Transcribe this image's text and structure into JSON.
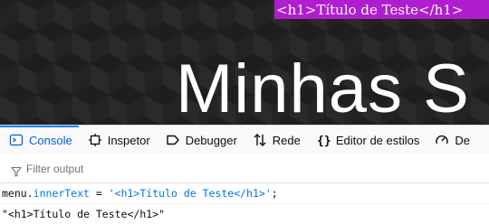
{
  "page": {
    "highlight_label": "<h1>Título de Teste</h1>",
    "hero_title": "Minhas S"
  },
  "devtools": {
    "tabs": [
      {
        "label": "Console",
        "icon": "console-icon",
        "selected": true
      },
      {
        "label": "Inspetor",
        "icon": "inspector-icon",
        "selected": false
      },
      {
        "label": "Debugger",
        "icon": "debugger-icon",
        "selected": false
      },
      {
        "label": "Rede",
        "icon": "network-icon",
        "selected": false
      },
      {
        "label": "Editor de estilos",
        "icon": "style-editor-icon",
        "selected": false
      },
      {
        "label": "De",
        "icon": "performance-icon",
        "selected": false
      }
    ],
    "filter": {
      "placeholder": "Filter output",
      "value": ""
    },
    "console": {
      "input": {
        "object": "menu",
        "dot": ".",
        "property": "innerText",
        "operator": " = ",
        "string": "'<h1>Título de Teste</h1>'",
        "end": ";"
      },
      "result": "\"<h1>Título de Teste</h1>\""
    }
  },
  "colors": {
    "highlight_bg": "#b01dd1",
    "selected_tab": "#0060df",
    "selected_bar": "#0a84ff",
    "code_blue": "#0074e8",
    "page_bg": "#232323"
  }
}
